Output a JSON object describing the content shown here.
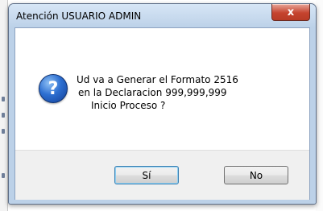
{
  "dialog": {
    "title": "Atención USUARIO ADMIN",
    "close_label": "x",
    "icon": "question-icon",
    "message_lines": [
      "Ud va a Generar el Formato 2516",
      "en la Declaracion 999,999,999",
      "Inicio Proceso ?"
    ],
    "buttons": {
      "yes": "Sí",
      "no": "No"
    }
  },
  "colors": {
    "frame": "#bcd1e8",
    "close_button": "#c5442f",
    "question_icon": "#2d6fd1",
    "default_button_border": "#3c7fb1"
  }
}
